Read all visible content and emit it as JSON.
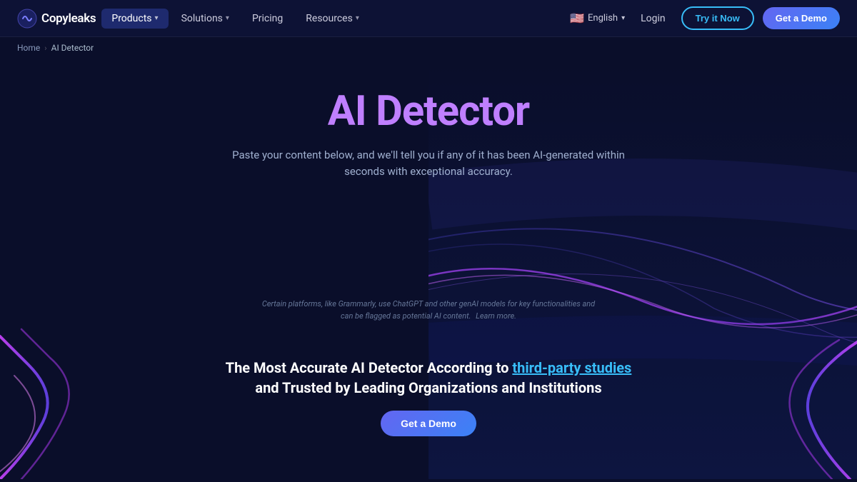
{
  "brand": {
    "logo_text": "Copyleaks"
  },
  "navbar": {
    "products_label": "Products",
    "solutions_label": "Solutions",
    "pricing_label": "Pricing",
    "resources_label": "Resources",
    "lang_label": "English",
    "login_label": "Login",
    "try_now_label": "Try it Now",
    "get_demo_label": "Get a Demo"
  },
  "breadcrumb": {
    "home_label": "Home",
    "current_label": "AI Detector"
  },
  "hero": {
    "title": "AI Detector",
    "subtitle": "Paste your content below, and we'll tell you if any of it has been AI-generated within seconds with exceptional accuracy."
  },
  "disclaimer": {
    "text": "Certain platforms, like Grammarly, use ChatGPT and other genAI models for key functionalities and can be flagged as potential AI content.",
    "link_text": "Learn more."
  },
  "bottom_cta": {
    "title_start": "The Most Accurate AI Detector According to ",
    "link_text": "third-party studies",
    "title_end": " and Trusted by Leading Organizations and Institutions",
    "button_label": "Get a Demo"
  }
}
